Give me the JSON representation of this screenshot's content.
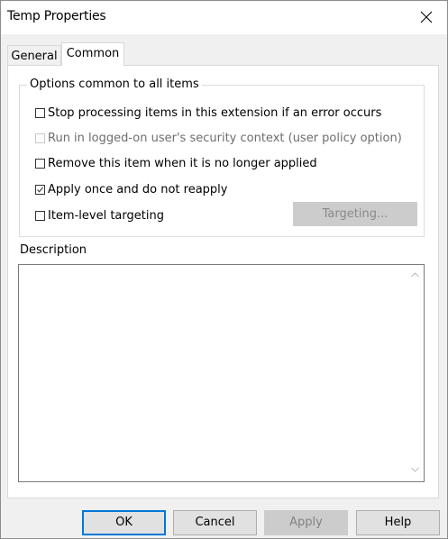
{
  "window": {
    "title": "Temp Properties",
    "close_icon": "close-icon"
  },
  "tabs": [
    {
      "label": "General",
      "selected": false
    },
    {
      "label": "Common",
      "selected": true
    }
  ],
  "options_group": {
    "legend": "Options common to all items",
    "items": [
      {
        "label": "Stop processing items in this extension if an error occurs",
        "checked": false,
        "enabled": true
      },
      {
        "label": "Run in logged-on user's security context (user policy option)",
        "checked": false,
        "enabled": false
      },
      {
        "label": "Remove this item when it is no longer applied",
        "checked": false,
        "enabled": true
      },
      {
        "label": "Apply once and do not reapply",
        "checked": true,
        "enabled": true
      },
      {
        "label": "Item-level targeting",
        "checked": false,
        "enabled": true
      }
    ],
    "targeting_button": "Targeting..."
  },
  "description": {
    "label": "Description",
    "value": ""
  },
  "buttons": {
    "ok": "OK",
    "cancel": "Cancel",
    "apply": "Apply",
    "help": "Help"
  },
  "colors": {
    "focus_border": "#0078d7",
    "disabled_button": "#cccccc",
    "disabled_text": "#6d6d6d"
  }
}
